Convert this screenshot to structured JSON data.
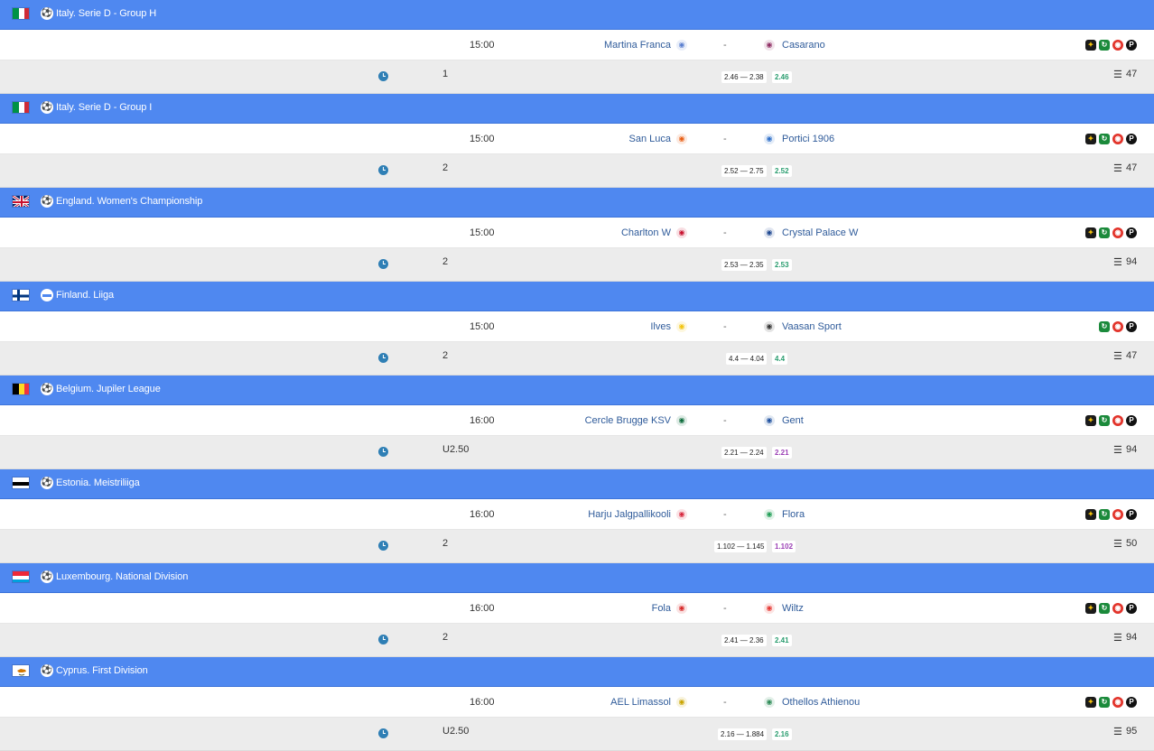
{
  "leagues": [
    {
      "name": "Italy. Serie D - Group H",
      "flag": "italy",
      "sport_icon": "soccer-ball-icon",
      "match": {
        "time": "15:00",
        "home": "Martina Franca",
        "away": "Casarano",
        "separator": "-",
        "home_badge": "#5a7fcf",
        "away_badge": "#8e2d63",
        "bookmakers": 4
      },
      "pred": {
        "tip": "1",
        "odds_range": "2.46 — 2.38",
        "odds_final": "2.46",
        "odds_color": "#2a9d6f",
        "count": "47"
      }
    },
    {
      "name": "Italy. Serie D - Group I",
      "flag": "italy",
      "sport_icon": "soccer-ball-icon",
      "match": {
        "time": "15:00",
        "home": "San Luca",
        "away": "Portici 1906",
        "separator": "-",
        "home_badge": "#e85d12",
        "away_badge": "#2f6fc9",
        "bookmakers": 4
      },
      "pred": {
        "tip": "2",
        "odds_range": "2.52 — 2.75",
        "odds_final": "2.52",
        "odds_color": "#2a9d6f",
        "count": "47"
      }
    },
    {
      "name": "England. Women's Championship",
      "flag": "uk",
      "sport_icon": "soccer-ball-icon",
      "match": {
        "time": "15:00",
        "home": "Charlton W",
        "away": "Crystal Palace W",
        "separator": "-",
        "home_badge": "#c8102e",
        "away_badge": "#1b458f",
        "bookmakers": 4
      },
      "pred": {
        "tip": "2",
        "odds_range": "2.53 — 2.35",
        "odds_final": "2.53",
        "odds_color": "#2a9d6f",
        "count": "94"
      }
    },
    {
      "name": "Finland. Liiga",
      "flag": "finland",
      "sport_icon": "hockey-puck-icon",
      "match": {
        "time": "15:00",
        "home": "Ilves",
        "away": "Vaasan Sport",
        "separator": "-",
        "home_badge": "#f2c40f",
        "away_badge": "#333333",
        "bookmakers": 3
      },
      "pred": {
        "tip": "2",
        "odds_range": "4.4 — 4.04",
        "odds_final": "4.4",
        "odds_color": "#2a9d6f",
        "count": "47"
      }
    },
    {
      "name": "Belgium. Jupiler League",
      "flag": "belgium",
      "sport_icon": "soccer-ball-icon",
      "match": {
        "time": "16:00",
        "home": "Cercle Brugge KSV",
        "away": "Gent",
        "separator": "-",
        "home_badge": "#0b6b3a",
        "away_badge": "#1d4f9e",
        "bookmakers": 4
      },
      "pred": {
        "tip": "U2.50",
        "odds_range": "2.21 — 2.24",
        "odds_final": "2.21",
        "odds_color": "#9b3fb5",
        "count": "94"
      }
    },
    {
      "name": "Estonia. Meistriliiga",
      "flag": "estonia",
      "sport_icon": "soccer-ball-icon",
      "match": {
        "time": "16:00",
        "home": "Harju Jalgpallikooli",
        "away": "Flora",
        "separator": "-",
        "home_badge": "#d7263d",
        "away_badge": "#1f9d55",
        "bookmakers": 4
      },
      "pred": {
        "tip": "2",
        "odds_range": "1.102 — 1.145",
        "odds_final": "1.102",
        "odds_color": "#9b3fb5",
        "count": "50"
      }
    },
    {
      "name": "Luxembourg. National Division",
      "flag": "luxembourg",
      "sport_icon": "soccer-ball-icon",
      "match": {
        "time": "16:00",
        "home": "Fola",
        "away": "Wiltz",
        "separator": "-",
        "home_badge": "#d62828",
        "away_badge": "#e53935",
        "bookmakers": 4
      },
      "pred": {
        "tip": "2",
        "odds_range": "2.41 — 2.36",
        "odds_final": "2.41",
        "odds_color": "#2a9d6f",
        "count": "94"
      }
    },
    {
      "name": "Cyprus. First Division",
      "flag": "cyprus",
      "sport_icon": "soccer-ball-icon",
      "match": {
        "time": "16:00",
        "home": "AEL Limassol",
        "away": "Othellos Athienou",
        "separator": "-",
        "home_badge": "#c9a400",
        "away_badge": "#2e8b57",
        "bookmakers": 4
      },
      "pred": {
        "tip": "U2.50",
        "odds_range": "2.16 — 1.884",
        "odds_final": "2.16",
        "odds_color": "#2a9d6f",
        "count": "95"
      }
    }
  ]
}
